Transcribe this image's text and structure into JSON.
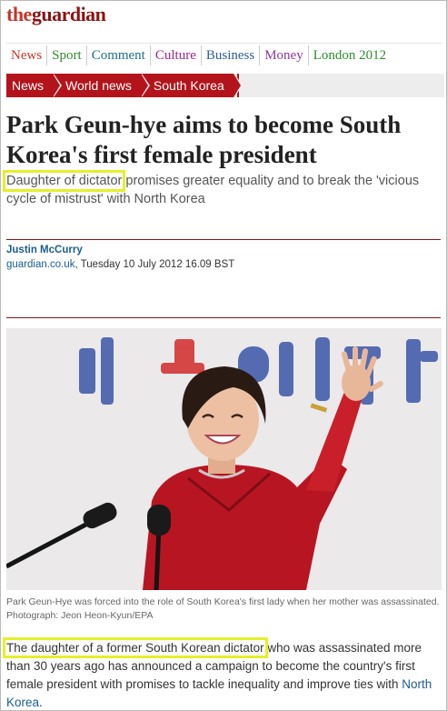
{
  "logo": {
    "part1": "the",
    "part2": "guardian"
  },
  "sections": [
    {
      "label": "News",
      "color": "#c0392b"
    },
    {
      "label": "Sport",
      "color": "#2e8b2e"
    },
    {
      "label": "Comment",
      "color": "#1f6e8c"
    },
    {
      "label": "Culture",
      "color": "#a3258f"
    },
    {
      "label": "Business",
      "color": "#2f5c9c"
    },
    {
      "label": "Money",
      "color": "#8a3aa6"
    },
    {
      "label": "London 2012",
      "color": "#2e8b2e"
    }
  ],
  "breadcrumbs": [
    "News",
    "World news",
    "South Korea"
  ],
  "article": {
    "headline": "Park Geun-hye aims to become South Korea's first female president",
    "standfirst_highlight": "Daughter of dictator",
    "standfirst_rest": " promises greater equality and to break the 'vicious cycle of mistrust' with North Korea",
    "author": "Justin McCurry",
    "site": "guardian.co.uk",
    "dateline": ", Tuesday 10 July 2012 16.09 BST",
    "caption": "Park Geun-Hye was forced into the role of South Korea's first lady when her mother was assassinated. Photograph: Jeon Heon-Kyun/EPA",
    "body_highlight": "The daughter of a former South Korean dictator",
    "body_rest": " who was assassinated more than 30 years ago has announced a campaign to become the country's first female president with promises to tackle inequality and improve ties with ",
    "body_link": "North Korea",
    "body_end": "."
  },
  "colors": {
    "brand": "#b3141b",
    "highlight": "#e4f02a",
    "link": "#1b5c8f"
  }
}
